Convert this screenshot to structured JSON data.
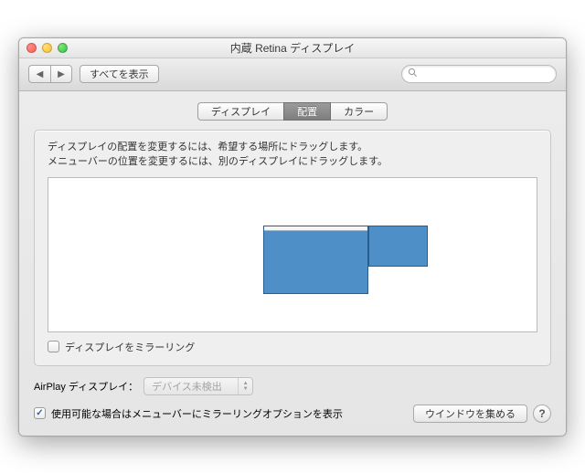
{
  "window": {
    "title": "内蔵 Retina ディスプレイ"
  },
  "toolbar": {
    "show_all": "すべてを表示",
    "search_placeholder": ""
  },
  "tabs": {
    "display": "ディスプレイ",
    "arrangement": "配置",
    "color": "カラー",
    "active": "arrangement"
  },
  "arrangement": {
    "instructions_line1": "ディスプレイの配置を変更するには、希望する場所にドラッグします。",
    "instructions_line2": "メニューバーの位置を変更するには、別のディスプレイにドラッグします。",
    "mirror_label": "ディスプレイをミラーリング",
    "mirror_checked": false
  },
  "airplay": {
    "label": "AirPlay ディスプレイ：",
    "selected": "デバイス未検出",
    "enabled": false
  },
  "footer": {
    "show_mirror_option_label": "使用可能な場合はメニューバーにミラーリングオプションを表示",
    "show_mirror_option_checked": true,
    "gather_windows": "ウインドウを集める"
  }
}
